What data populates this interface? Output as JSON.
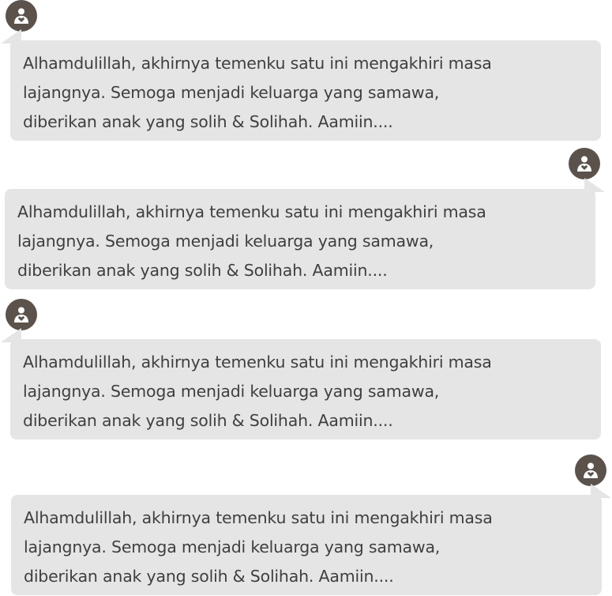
{
  "colors": {
    "avatar_bg": "#5b524b",
    "bubble_bg": "#e5e5e5",
    "text": "#3f3f3f"
  },
  "messages": [
    {
      "side": "left",
      "avatar_icon": "user-heart-icon",
      "lines": [
        "Alhamdulillah, akhirnya temenku satu ini mengakhiri masa",
        "lajangnya. Semoga menjadi keluarga yang samawa,",
        "diberikan anak yang solih & Solihah. Aamiin...."
      ]
    },
    {
      "side": "right",
      "avatar_icon": "user-heart-icon",
      "lines": [
        "Alhamdulillah, akhirnya temenku satu ini mengakhiri masa",
        "lajangnya. Semoga menjadi keluarga yang samawa,",
        "diberikan anak yang solih & Solihah. Aamiin...."
      ]
    },
    {
      "side": "left",
      "avatar_icon": "user-heart-icon",
      "lines": [
        "Alhamdulillah, akhirnya temenku satu ini mengakhiri masa",
        "lajangnya. Semoga menjadi keluarga yang samawa,",
        "diberikan anak yang solih & Solihah. Aamiin...."
      ]
    },
    {
      "side": "right",
      "avatar_icon": "user-heart-icon",
      "lines": [
        "Alhamdulillah, akhirnya temenku satu ini mengakhiri masa",
        "lajangnya. Semoga menjadi keluarga yang samawa,",
        "diberikan anak yang solih & Solihah. Aamiin...."
      ]
    }
  ]
}
